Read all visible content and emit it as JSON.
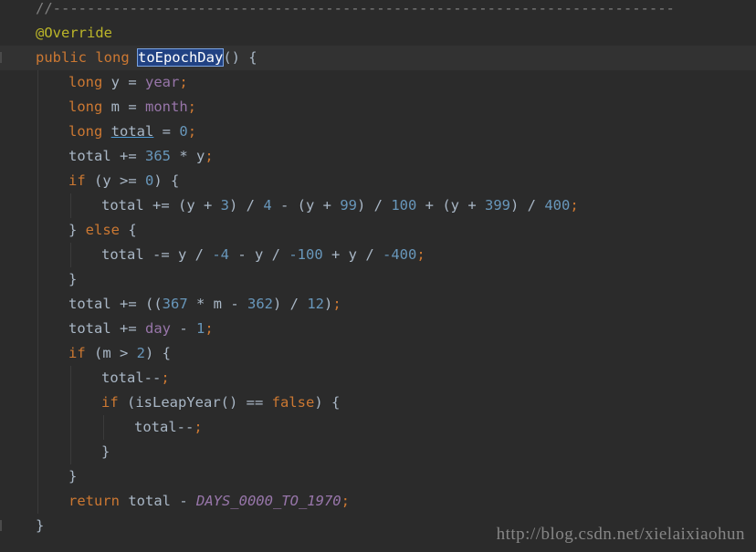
{
  "editor": {
    "lines": [
      {
        "indent": 0,
        "tokens": [
          {
            "t": "//-------------------------------------------------------------------------",
            "c": "comment"
          }
        ]
      },
      {
        "indent": 0,
        "tokens": [
          {
            "t": "@Override",
            "c": "ann"
          }
        ]
      },
      {
        "indent": 0,
        "tokens": [
          {
            "t": "public long ",
            "c": "kw"
          },
          {
            "t": "toEpochDay",
            "c": "selected"
          },
          {
            "t": "() {",
            "c": "ident"
          }
        ]
      },
      {
        "indent": 1,
        "tokens": [
          {
            "t": "long ",
            "c": "kw"
          },
          {
            "t": "y = ",
            "c": "ident"
          },
          {
            "t": "year",
            "c": "field"
          },
          {
            "t": ";",
            "c": "punct"
          }
        ]
      },
      {
        "indent": 1,
        "tokens": [
          {
            "t": "long ",
            "c": "kw"
          },
          {
            "t": "m = ",
            "c": "ident"
          },
          {
            "t": "month",
            "c": "field"
          },
          {
            "t": ";",
            "c": "punct"
          }
        ]
      },
      {
        "indent": 1,
        "tokens": [
          {
            "t": "long ",
            "c": "kw"
          },
          {
            "t": "total",
            "c": "underline"
          },
          {
            "t": " = ",
            "c": "ident"
          },
          {
            "t": "0",
            "c": "num"
          },
          {
            "t": ";",
            "c": "punct"
          }
        ]
      },
      {
        "indent": 1,
        "tokens": [
          {
            "t": "total += ",
            "c": "ident"
          },
          {
            "t": "365",
            "c": "num"
          },
          {
            "t": " * y",
            "c": "ident"
          },
          {
            "t": ";",
            "c": "punct"
          }
        ]
      },
      {
        "indent": 1,
        "tokens": [
          {
            "t": "if ",
            "c": "kw"
          },
          {
            "t": "(y >= ",
            "c": "ident"
          },
          {
            "t": "0",
            "c": "num"
          },
          {
            "t": ") {",
            "c": "ident"
          }
        ]
      },
      {
        "indent": 2,
        "tokens": [
          {
            "t": "total += (y + ",
            "c": "ident"
          },
          {
            "t": "3",
            "c": "num"
          },
          {
            "t": ") / ",
            "c": "ident"
          },
          {
            "t": "4",
            "c": "num"
          },
          {
            "t": " - (y + ",
            "c": "ident"
          },
          {
            "t": "99",
            "c": "num"
          },
          {
            "t": ") / ",
            "c": "ident"
          },
          {
            "t": "100",
            "c": "num"
          },
          {
            "t": " + (y + ",
            "c": "ident"
          },
          {
            "t": "399",
            "c": "num"
          },
          {
            "t": ") / ",
            "c": "ident"
          },
          {
            "t": "400",
            "c": "num"
          },
          {
            "t": ";",
            "c": "punct"
          }
        ]
      },
      {
        "indent": 1,
        "tokens": [
          {
            "t": "} ",
            "c": "ident"
          },
          {
            "t": "else ",
            "c": "kw"
          },
          {
            "t": "{",
            "c": "ident"
          }
        ]
      },
      {
        "indent": 2,
        "tokens": [
          {
            "t": "total -= y / ",
            "c": "ident"
          },
          {
            "t": "-4",
            "c": "num"
          },
          {
            "t": " - y / ",
            "c": "ident"
          },
          {
            "t": "-100",
            "c": "num"
          },
          {
            "t": " + y / ",
            "c": "ident"
          },
          {
            "t": "-400",
            "c": "num"
          },
          {
            "t": ";",
            "c": "punct"
          }
        ]
      },
      {
        "indent": 1,
        "tokens": [
          {
            "t": "}",
            "c": "ident"
          }
        ]
      },
      {
        "indent": 1,
        "tokens": [
          {
            "t": "total += ((",
            "c": "ident"
          },
          {
            "t": "367",
            "c": "num"
          },
          {
            "t": " * m - ",
            "c": "ident"
          },
          {
            "t": "362",
            "c": "num"
          },
          {
            "t": ") / ",
            "c": "ident"
          },
          {
            "t": "12",
            "c": "num"
          },
          {
            "t": ")",
            "c": "ident"
          },
          {
            "t": ";",
            "c": "punct"
          }
        ]
      },
      {
        "indent": 1,
        "tokens": [
          {
            "t": "total += ",
            "c": "ident"
          },
          {
            "t": "day",
            "c": "field"
          },
          {
            "t": " - ",
            "c": "ident"
          },
          {
            "t": "1",
            "c": "num"
          },
          {
            "t": ";",
            "c": "punct"
          }
        ]
      },
      {
        "indent": 1,
        "tokens": [
          {
            "t": "if ",
            "c": "kw"
          },
          {
            "t": "(m > ",
            "c": "ident"
          },
          {
            "t": "2",
            "c": "num"
          },
          {
            "t": ") {",
            "c": "ident"
          }
        ]
      },
      {
        "indent": 2,
        "tokens": [
          {
            "t": "total--",
            "c": "ident"
          },
          {
            "t": ";",
            "c": "punct"
          }
        ]
      },
      {
        "indent": 2,
        "tokens": [
          {
            "t": "if ",
            "c": "kw"
          },
          {
            "t": "(isLeapYear() == ",
            "c": "ident"
          },
          {
            "t": "false",
            "c": "kw"
          },
          {
            "t": ") {",
            "c": "ident"
          }
        ]
      },
      {
        "indent": 3,
        "tokens": [
          {
            "t": "total--",
            "c": "ident"
          },
          {
            "t": ";",
            "c": "punct"
          }
        ]
      },
      {
        "indent": 2,
        "tokens": [
          {
            "t": "}",
            "c": "ident"
          }
        ]
      },
      {
        "indent": 1,
        "tokens": [
          {
            "t": "}",
            "c": "ident"
          }
        ]
      },
      {
        "indent": 1,
        "tokens": [
          {
            "t": "return ",
            "c": "kw"
          },
          {
            "t": "total - ",
            "c": "ident"
          },
          {
            "t": "DAYS_0000_TO_1970",
            "c": "const"
          },
          {
            "t": ";",
            "c": "punct"
          }
        ]
      },
      {
        "indent": 0,
        "tokens": [
          {
            "t": "}",
            "c": "ident"
          }
        ]
      }
    ],
    "watermark": "http://blog.csdn.net/xielaixiaohun",
    "colors": {
      "background": "#2b2b2b",
      "keyword": "#cc7832",
      "number": "#6897bb",
      "field": "#9876aa",
      "annotation": "#bbb529",
      "selection": "#214283"
    }
  }
}
